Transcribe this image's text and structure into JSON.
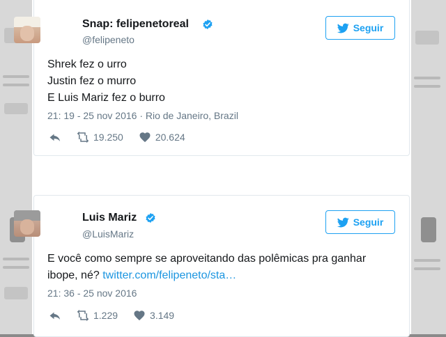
{
  "tweets": [
    {
      "display_name": "Snap: felipenetoreal",
      "handle": "@felipeneto",
      "follow_label": "Seguir",
      "lines": [
        "Shrek fez o urro",
        "Justin fez o murro",
        "E Luis Mariz fez o burro"
      ],
      "timestamp": "21: 19 - 25 nov 2016 · Rio de Janeiro, Brazil",
      "retweets": "19.250",
      "likes": "20.624"
    },
    {
      "display_name": "Luis Mariz",
      "handle": "@LuisMariz",
      "follow_label": "Seguir",
      "line1": "E você como sempre se aproveitando das polêmicas pra ganhar",
      "line2_prefix": "ibope, né?",
      "link_text": "twitter.com/felipeneto/sta…",
      "timestamp": "21: 36 - 25 nov 2016",
      "retweets": "1.229",
      "likes": "3.149"
    }
  ],
  "colors": {
    "accent": "#1da1f2",
    "link": "#1b95e0",
    "muted": "#657786",
    "text": "#14171a"
  }
}
